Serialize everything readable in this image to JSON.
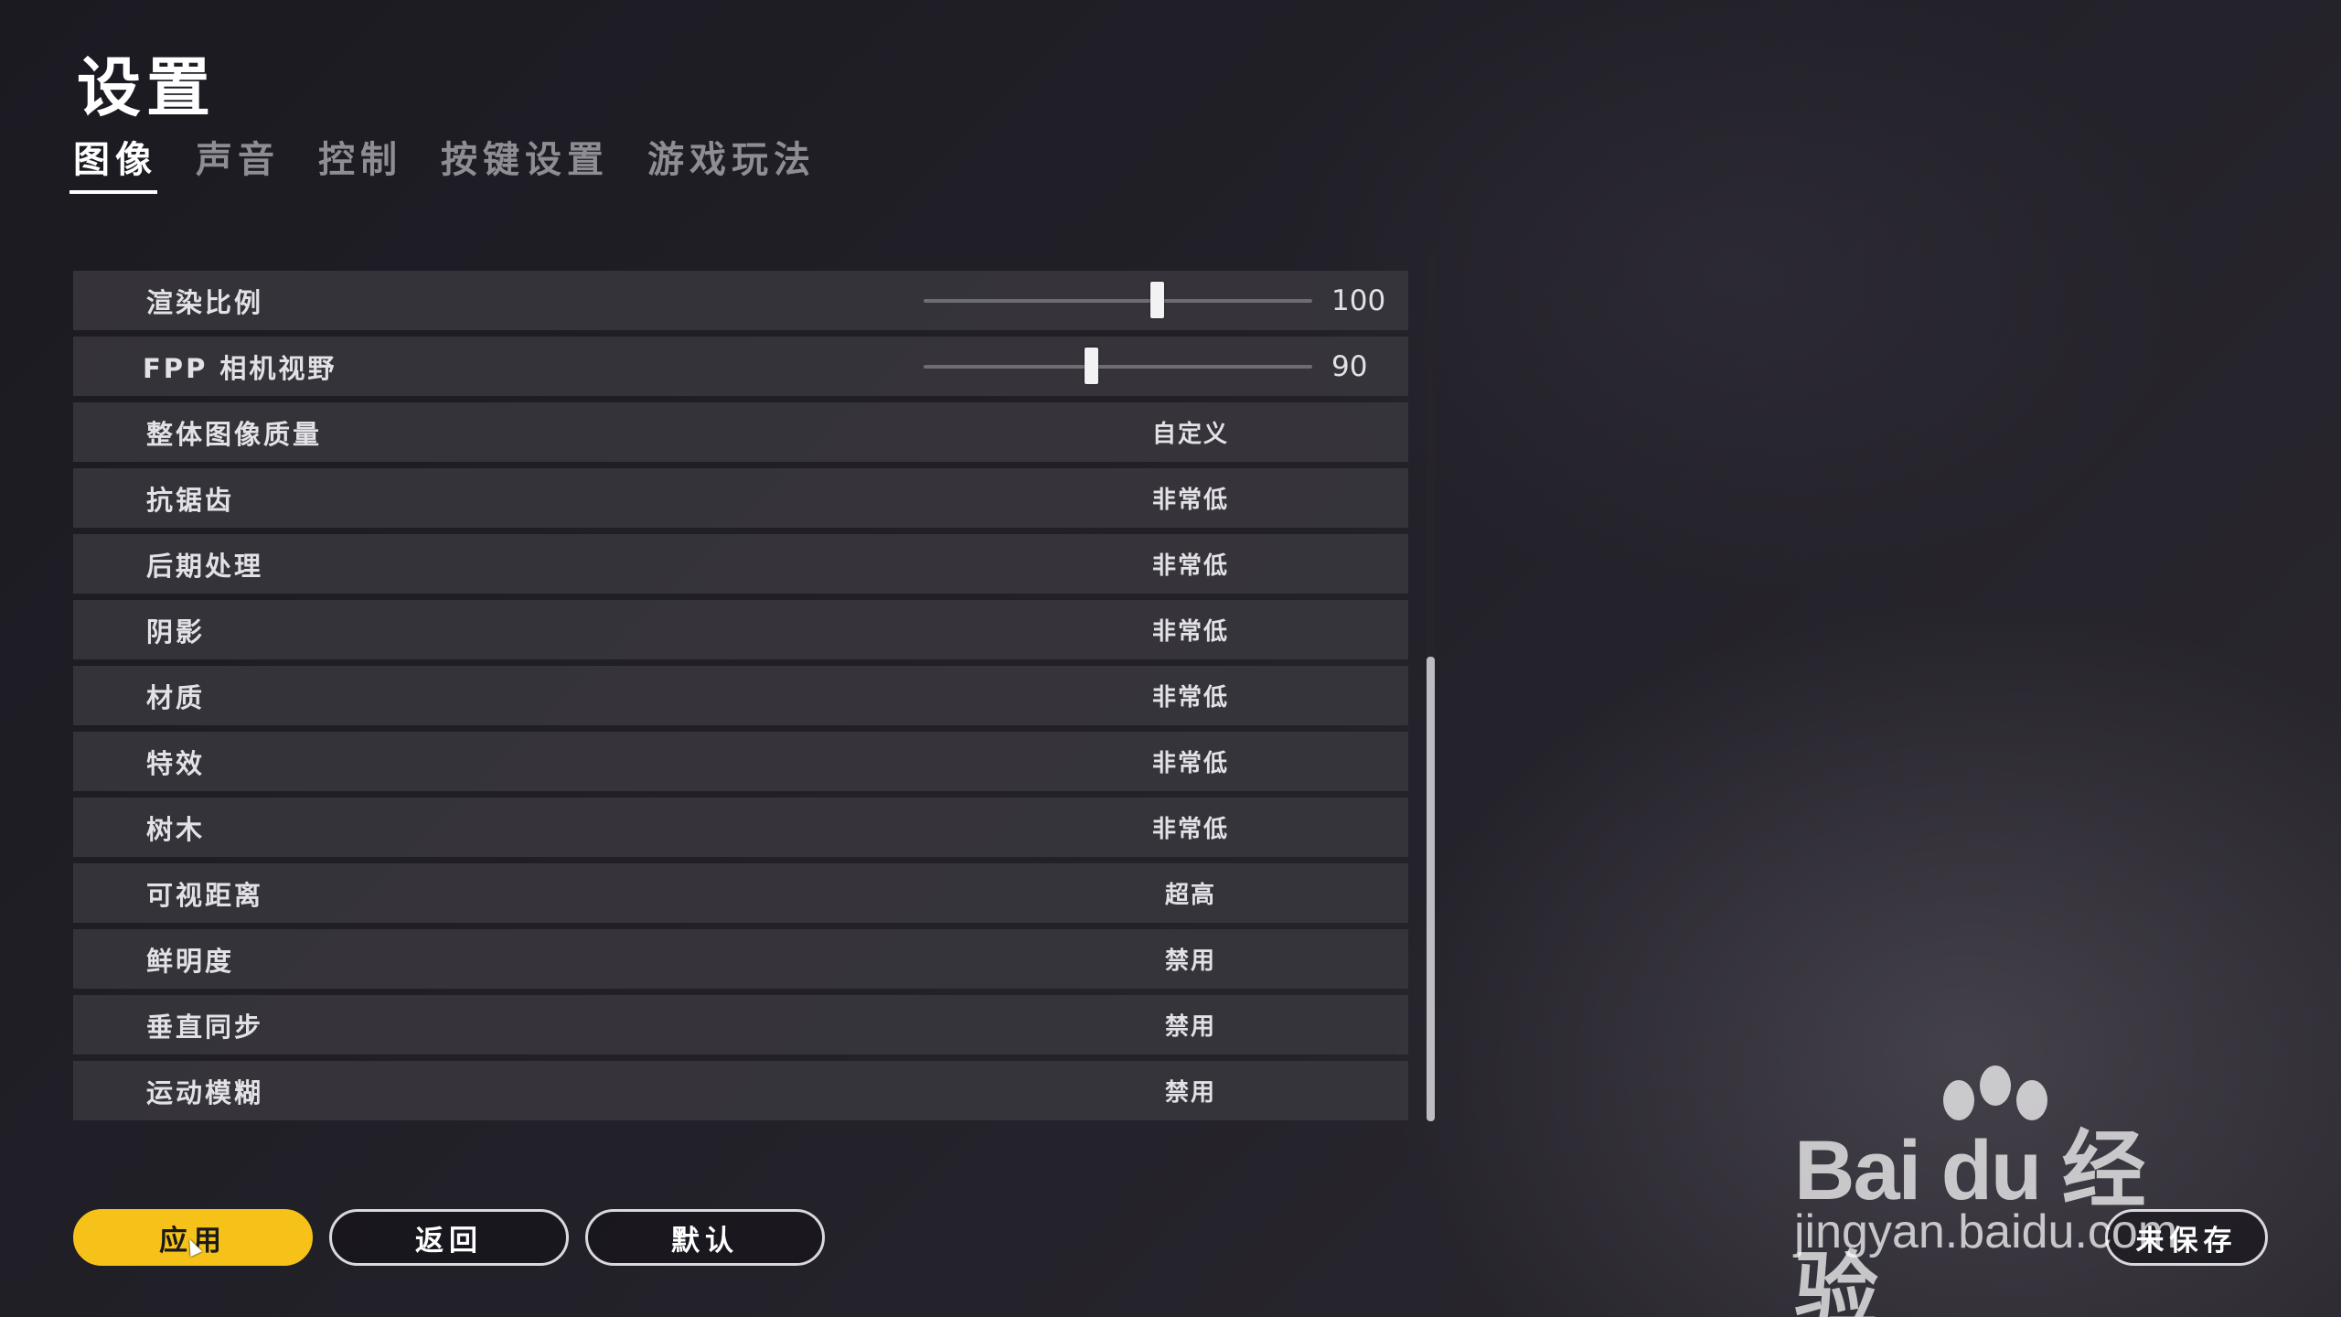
{
  "header": {
    "title": "设置"
  },
  "tabs": [
    {
      "label": "图像",
      "active": true
    },
    {
      "label": "声音",
      "active": false
    },
    {
      "label": "控制",
      "active": false
    },
    {
      "label": "按键设置",
      "active": false
    },
    {
      "label": "游戏玩法",
      "active": false
    }
  ],
  "settings": {
    "sliders": [
      {
        "label": "渲染比例",
        "value": "100",
        "fraction": 0.6
      },
      {
        "label": "FPP 相机视野",
        "value": "90",
        "fraction": 0.43
      }
    ],
    "options": [
      {
        "label": "整体图像质量",
        "value": "自定义"
      },
      {
        "label": "抗锯齿",
        "value": "非常低"
      },
      {
        "label": "后期处理",
        "value": "非常低"
      },
      {
        "label": "阴影",
        "value": "非常低"
      },
      {
        "label": "材质",
        "value": "非常低"
      },
      {
        "label": "特效",
        "value": "非常低"
      },
      {
        "label": "树木",
        "value": "非常低"
      },
      {
        "label": "可视距离",
        "value": "超高"
      },
      {
        "label": "鲜明度",
        "value": "禁用"
      },
      {
        "label": "垂直同步",
        "value": "禁用"
      },
      {
        "label": "运动模糊",
        "value": "禁用"
      }
    ]
  },
  "footer": {
    "apply_label": "应用",
    "back_label": "返回",
    "default_label": "默认",
    "unsaved_label": "未保存"
  },
  "watermark": {
    "brand": "Bai du 经验",
    "url": "jingyan.baidu.com"
  },
  "colors": {
    "accent": "#f6c21a",
    "row_bg": "#3a3840",
    "text": "#e2e2e6"
  }
}
